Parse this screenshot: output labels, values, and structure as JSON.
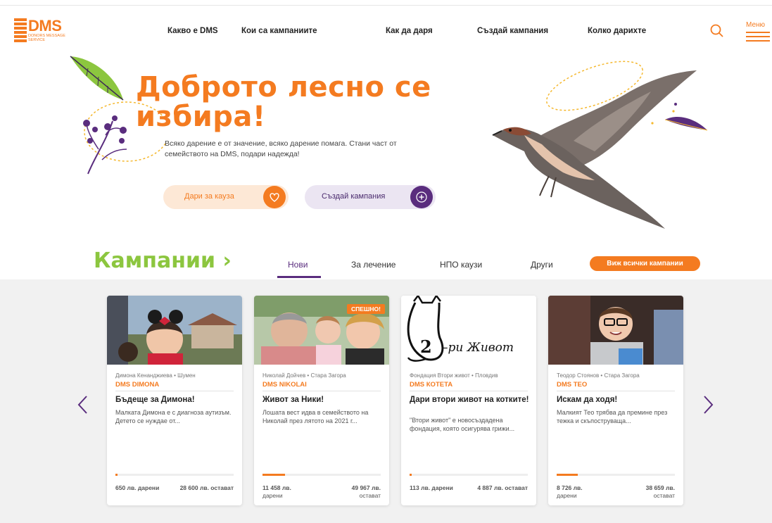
{
  "brand": {
    "name": "DMS",
    "subtitle": "DONORS MESSAGE SERVICE",
    "accent": "#f47b20",
    "purple": "#5a2d7e",
    "green": "#8cc63f"
  },
  "nav": {
    "items": [
      "Какво е DMS",
      "Кои са кампаниите",
      "Как да даря",
      "Създай кампания",
      "Колко дарихте"
    ],
    "menu_label": "Меню"
  },
  "hero": {
    "title_line1": "Доброто лесно се",
    "title_line2": "избира!",
    "text": "Всяко дарение е от значение, всяко дарение помага. Стани част от семейството на DMS, подари надежда!",
    "donate_button": "Дари за кауза",
    "create_button": "Създай кампания"
  },
  "campaigns": {
    "title": "Кампании ›",
    "tabs": [
      "Нови",
      "За лечение",
      "НПО каузи",
      "Други"
    ],
    "active_tab": "Нови",
    "view_all": "Виж всички кампании",
    "cards": [
      {
        "meta": "Димона Кенанджиева • Шумен",
        "org": "DMS DIMONA",
        "title": "Бъдеще за Димона!",
        "desc": "Малката Димона е с диагноза аутизъм. Детето се нуждае от...",
        "progress": 0.02,
        "stat_left": "650 лв. дарени",
        "stat_right": "28 600 лв. остават",
        "badge": ""
      },
      {
        "meta": "Николай Дойчев • Стара Загора",
        "org": "DMS NIKOLAI",
        "title": "Живот за Ники!",
        "desc": "Лошата вест идва в семейството на Николай през лятото на 2021 г...",
        "progress": 0.19,
        "stat_left": "11 458 лв.",
        "stat_left2": "дарени",
        "stat_right": "49 967 лв.",
        "stat_right2": "остават",
        "badge": "СПЕШНО!"
      },
      {
        "meta": "Фондация Втори живот • Пловдив",
        "org": "DMS КОТЕТА",
        "title": "Дари втори живот на котките!",
        "desc": "\"Втори живот\" е новосъздадена фондация, която осигурява грижи...",
        "progress": 0.02,
        "stat_left": "113 лв. дарени",
        "stat_right": "4 887 лв. остават",
        "badge": "",
        "logo_text": "2 -ри Живот"
      },
      {
        "meta": "Теодор Стоянов • Стара Загора",
        "org": "DMS TEO",
        "title": "Искам да ходя!",
        "desc": "Малкият Тео трябва да премине през тежка и скъпоструваща...",
        "progress": 0.18,
        "stat_left": "8 726 лв.",
        "stat_left2": "дарени",
        "stat_right": "38 659 лв.",
        "stat_right2": "остават",
        "badge": ""
      }
    ]
  },
  "icons": {
    "search": "search-icon",
    "heart": "heart-icon",
    "plus": "plus-icon",
    "prev": "chevron-left-icon",
    "next": "chevron-right-icon"
  }
}
